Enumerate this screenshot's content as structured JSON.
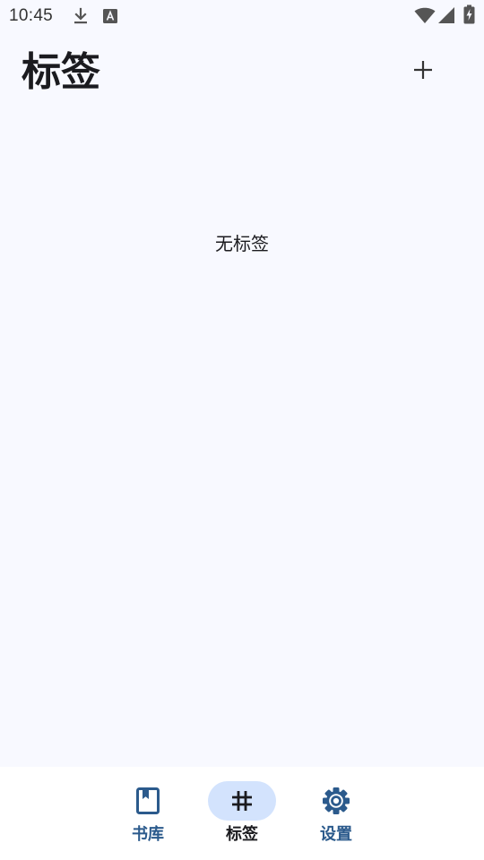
{
  "status_bar": {
    "time": "10:45",
    "icons": [
      "download-icon",
      "keyboard-a-icon",
      "wifi-icon",
      "cell-signal-icon",
      "battery-charging-icon"
    ]
  },
  "header": {
    "title": "标签",
    "add_icon": "plus-icon"
  },
  "main": {
    "empty_text": "无标签"
  },
  "bottom_nav": {
    "items": [
      {
        "label": "书库",
        "icon": "book-icon",
        "active": false
      },
      {
        "label": "标签",
        "icon": "hashtag-icon",
        "active": true
      },
      {
        "label": "设置",
        "icon": "gear-icon",
        "active": false
      }
    ],
    "colors": {
      "active_pill": "#d3e3fd",
      "inactive": "#2b5a8c",
      "active_icon": "#1b1b1f"
    }
  }
}
